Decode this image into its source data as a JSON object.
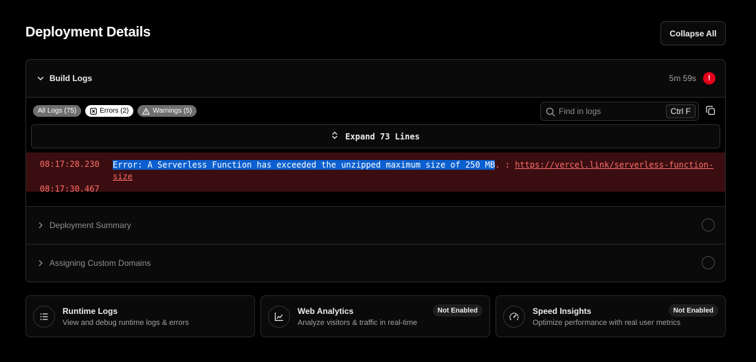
{
  "page": {
    "title": "Deployment Details",
    "collapse_all_label": "Collapse All"
  },
  "build_logs": {
    "title": "Build Logs",
    "duration": "5m 59s",
    "error_indicator": "!",
    "filters": [
      {
        "label": "All Logs (75)",
        "active": false
      },
      {
        "label": "Errors (2)",
        "active": true,
        "icon": "x-square-icon"
      },
      {
        "label": "Warnings (5)",
        "active": false,
        "icon": "warning-triangle-icon"
      }
    ],
    "search": {
      "placeholder": "Find in logs",
      "shortcut": "Ctrl F"
    },
    "expand_label": "Expand 73 Lines",
    "entries": [
      {
        "timestamp": "08:17:28.230",
        "message_highlighted": "Error: A Serverless Function has exceeded the unzipped maximum size of 250 MB",
        "message_rest": ". : ",
        "link": "https://vercel.link/serverless-function-size"
      },
      {
        "timestamp": "08:17:30.467"
      }
    ]
  },
  "sections": [
    {
      "label": "Deployment Summary"
    },
    {
      "label": "Assigning Custom Domains"
    }
  ],
  "cards": [
    {
      "title": "Runtime Logs",
      "description": "View and debug runtime logs & errors",
      "icon": "list-icon"
    },
    {
      "title": "Web Analytics",
      "description": "Analyze visitors & traffic in real-time",
      "icon": "chart-line-icon",
      "badge": "Not Enabled"
    },
    {
      "title": "Speed Insights",
      "description": "Optimize performance with real user metrics",
      "icon": "gauge-icon",
      "badge": "Not Enabled"
    }
  ],
  "colors": {
    "error_bg": "#3a0e10",
    "error_text": "#ff6b6b",
    "highlight": "#0b5fd0",
    "error_dot": "#e5001b"
  }
}
